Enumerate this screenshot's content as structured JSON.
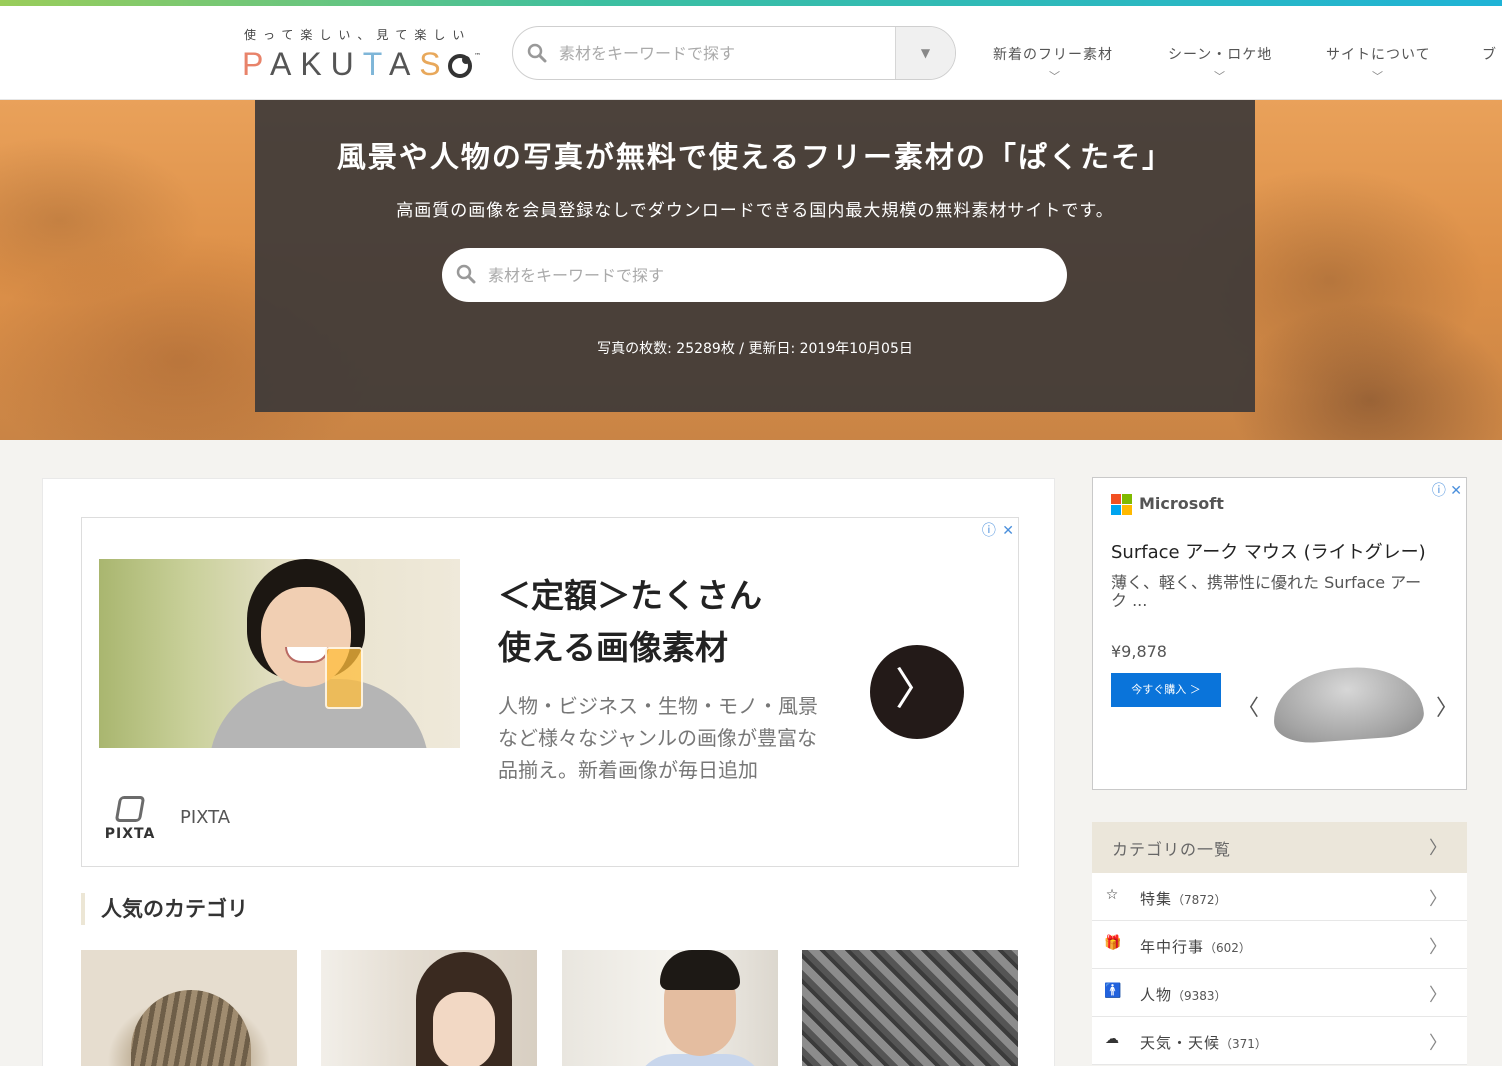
{
  "brand": {
    "tagline": "使って楽しい、見て楽しい",
    "logo_letters": [
      "P",
      "A",
      "K",
      "U",
      "T",
      "A",
      "S"
    ],
    "logo_trademark": "™"
  },
  "header": {
    "search_placeholder": "素材をキーワードで探す",
    "dropdown_icon": "▼",
    "nav": [
      {
        "label": "新着のフリー素材"
      },
      {
        "label": "シーン・ロケ地"
      },
      {
        "label": "サイトについて"
      },
      {
        "label": "ブ"
      }
    ]
  },
  "hero": {
    "title": "風景や人物の写真が無料で使えるフリー素材の「ぱくたそ」",
    "subtitle": "高画質の画像を会員登録なしでダウンロードできる国内最大規模の無料素材サイトです。",
    "search_placeholder": "素材をキーワードで探す",
    "stats": "写真の枚数: 25289枚 / 更新日: 2019年10月05日"
  },
  "ad_main": {
    "info_icon": "ⓘ",
    "close_icon": "✕",
    "headline_1": "＜定額＞たくさん",
    "headline_2": "使える画像素材",
    "description": "人物・ビジネス・生物・モノ・風景など様々なジャンルの画像が豊富な品揃え。新着画像が毎日追加",
    "advertiser_logo_text": "PIXTA",
    "advertiser": "PIXTA",
    "go_icon": "〉"
  },
  "popular": {
    "title": "人気のカテゴリ"
  },
  "ad_side": {
    "brand": "Microsoft",
    "product": "Surface アーク マウス (ライトグレー)",
    "description": "薄く、軽く、携帯性に優れた Surface アーク ...",
    "price": "¥9,878",
    "buy_label": "今すぐ購入 ＞",
    "prev_icon": "〈",
    "next_icon": "〉"
  },
  "categories": {
    "title": "カテゴリの一覧",
    "items": [
      {
        "icon": "☆",
        "label": "特集",
        "count": "（7872）"
      },
      {
        "icon": "🎁",
        "label": "年中行事",
        "count": "（602）"
      },
      {
        "icon": "🚹",
        "label": "人物",
        "count": "（9383）"
      },
      {
        "icon": "☁",
        "label": "天気・天候",
        "count": "（371）"
      }
    ]
  },
  "colors": {
    "accent_gradient": [
      "#9acd5a",
      "#1fb3d6"
    ],
    "hero_panel": "#3e3a38",
    "buy_button": "#0a74da",
    "category_header": "#ebe6da"
  }
}
